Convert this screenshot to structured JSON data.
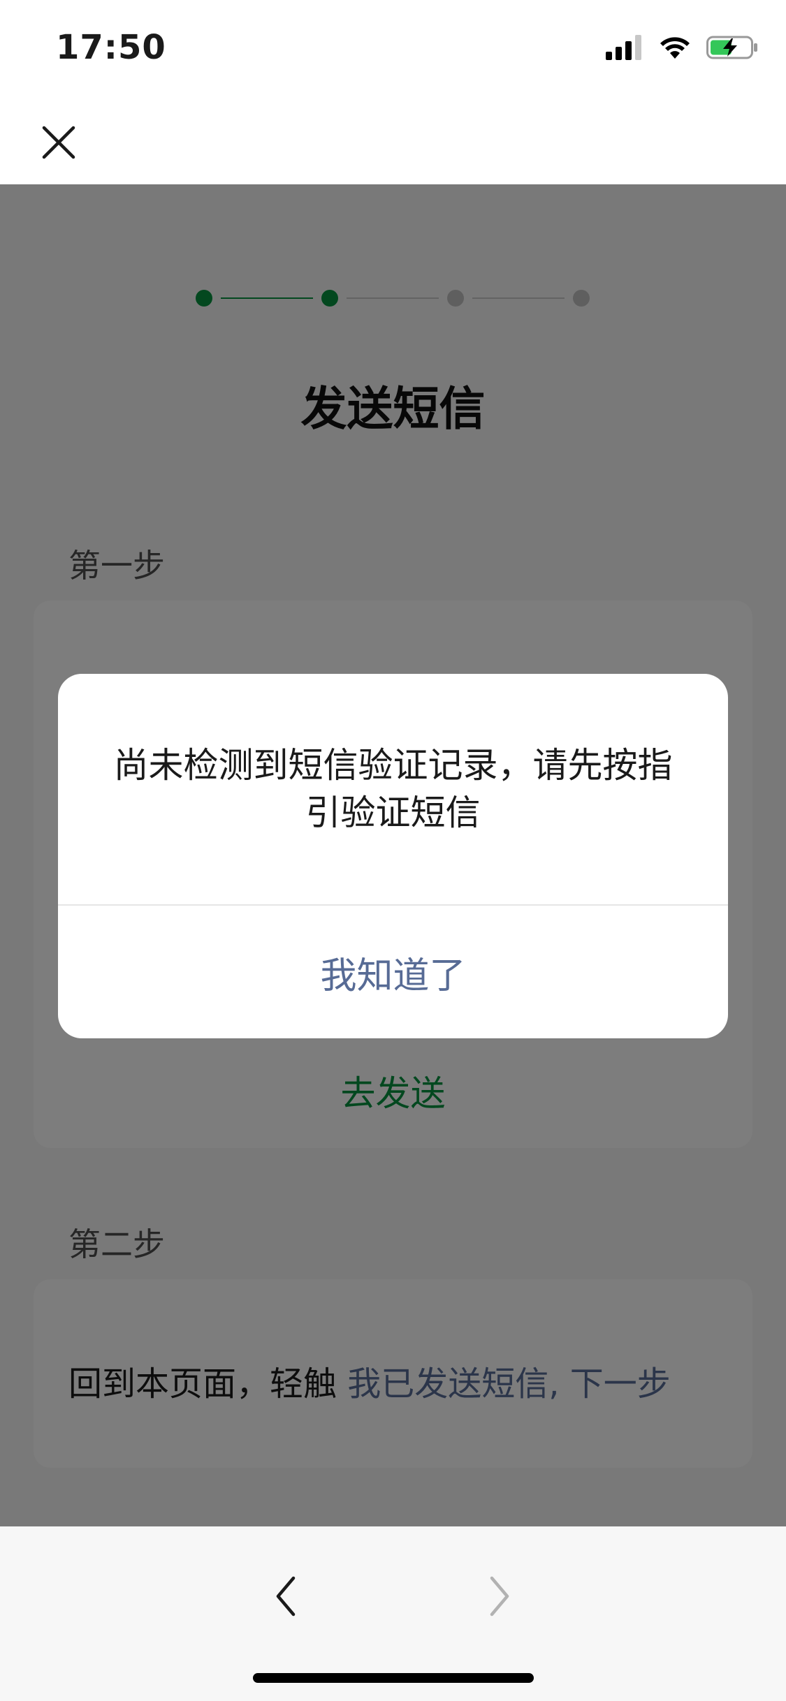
{
  "status_bar": {
    "time": "17:50",
    "icons": [
      "cellular-signal-icon",
      "wifi-icon",
      "battery-charging-icon"
    ]
  },
  "nav": {
    "close_icon": "close-icon"
  },
  "stepper": {
    "total_steps": 4,
    "current_step": 2,
    "active_color": "#07913f",
    "inactive_color": "#bfbfbf"
  },
  "page": {
    "title": "发送短信",
    "step1_label": "第一步",
    "step1_action": "去发送",
    "step2_label": "第二步",
    "step2_text": "回到本页面，轻触",
    "step2_link": "我已发送短信, 下一步"
  },
  "dialog": {
    "message": "尚未检测到短信验证记录，请先按指引验证短信",
    "confirm_label": "我知道了"
  },
  "bottom_nav": {
    "back_icon": "chevron-left-icon",
    "forward_icon": "chevron-right-icon"
  },
  "colors": {
    "accent_green": "#07913f",
    "link_blue": "#576b95"
  }
}
